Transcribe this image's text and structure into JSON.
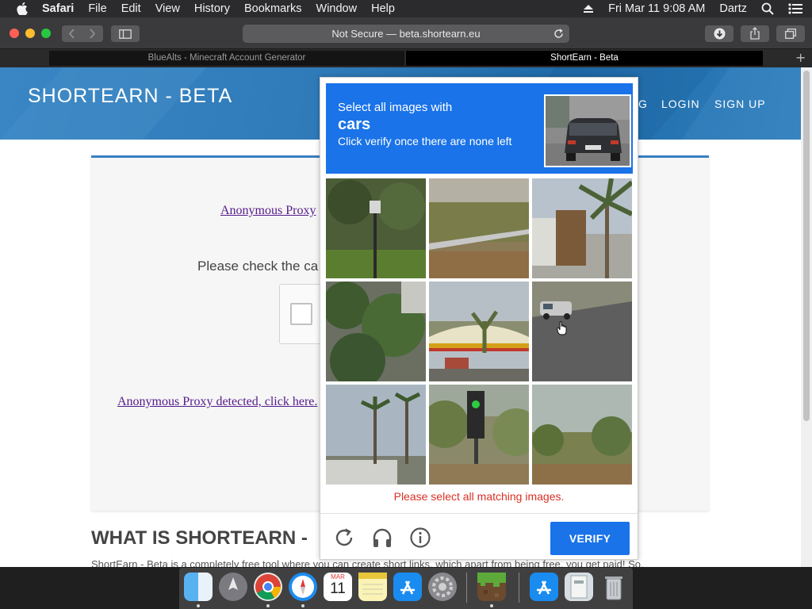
{
  "menubar": {
    "items": [
      "Safari",
      "File",
      "Edit",
      "View",
      "History",
      "Bookmarks",
      "Window",
      "Help"
    ],
    "datetime": "Fri Mar 11  9:08 AM",
    "user": "Dartz"
  },
  "browser": {
    "address": "Not Secure — beta.shortearn.eu",
    "tabs": [
      {
        "label": "BlueAlts - Minecraft Account Generator",
        "active": false
      },
      {
        "label": "ShortEarn - Beta",
        "active": true
      }
    ],
    "new_tab": "+"
  },
  "site": {
    "logo": "SHORTEARN - BETA",
    "nav": [
      "G",
      "LOGIN",
      "SIGN UP"
    ],
    "proxy_link_top": "Anonymous Proxy",
    "please_check": "Please check the ca",
    "proxy_link_bottom": "Anonymous Proxy detected, click here.",
    "section_title": "WHAT IS SHORTEARN -",
    "section_desc": "ShortEarn - Beta is a completely free tool where you can create short links, which apart from being free, you get paid! So,"
  },
  "captcha": {
    "instruction": "Select all images with",
    "target": "cars",
    "hint": "Click verify once there are none left",
    "error": "Please select all matching images.",
    "verify_label": "VERIFY",
    "tiles": [
      {
        "name": "tile-1",
        "subject": "street-lamp-greenery"
      },
      {
        "name": "tile-2",
        "subject": "guardrail-hillside"
      },
      {
        "name": "tile-3",
        "subject": "palm-tree-building"
      },
      {
        "name": "tile-4",
        "subject": "trees-bushes"
      },
      {
        "name": "tile-5",
        "subject": "gas-station"
      },
      {
        "name": "tile-6",
        "subject": "road-with-car"
      },
      {
        "name": "tile-7",
        "subject": "palms-sky"
      },
      {
        "name": "tile-8",
        "subject": "traffic-light"
      },
      {
        "name": "tile-9",
        "subject": "hillside-vegetation"
      }
    ]
  },
  "dock": {
    "apps": [
      "finder",
      "launchpad",
      "chrome",
      "safari",
      "calendar",
      "notes",
      "app-store",
      "system-preferences",
      "minecraft",
      "app-store-2",
      "downloads",
      "trash"
    ],
    "calendar_month": "MAR",
    "calendar_day": "11"
  }
}
